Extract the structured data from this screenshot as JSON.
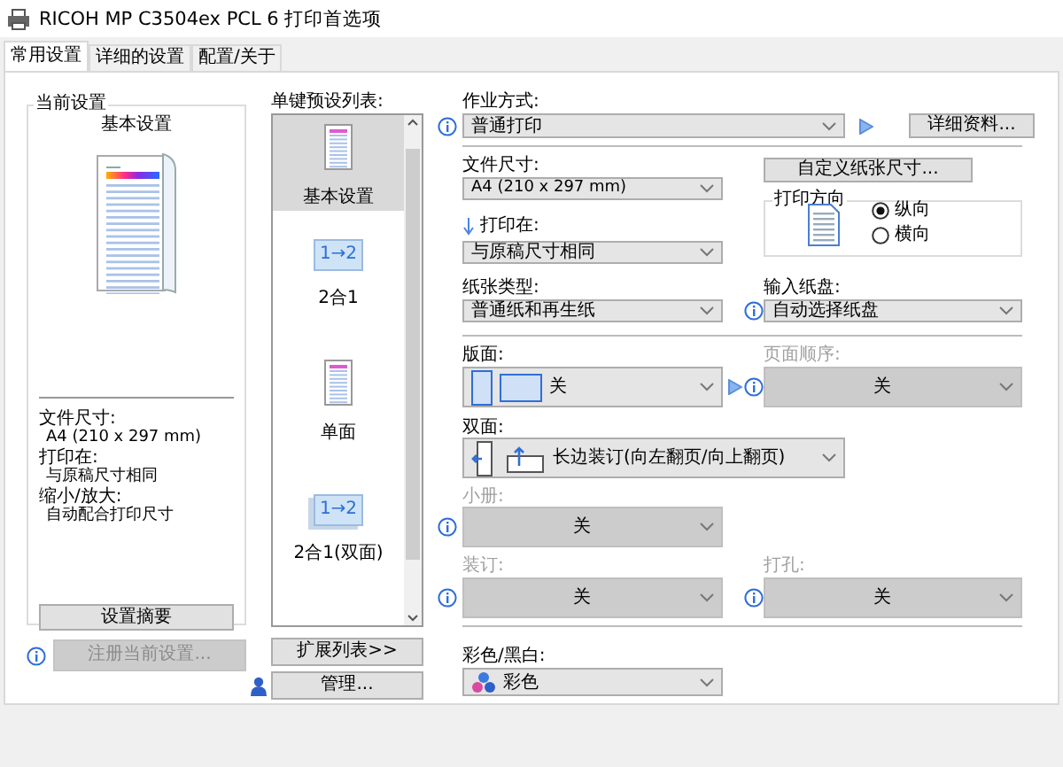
{
  "window": {
    "title": "RICOH MP C3504ex PCL 6 打印首选项"
  },
  "tabs": [
    {
      "label": "常用设置",
      "selected": true
    },
    {
      "label": "详细的设置",
      "selected": false
    },
    {
      "label": "配置/关于",
      "selected": false
    }
  ],
  "current_settings": {
    "title": "当前设置",
    "preset_name": "基本设置",
    "details": [
      {
        "label": "文件尺寸:",
        "value": "A4 (210 x 297 mm)"
      },
      {
        "label": "打印在:",
        "value": "与原稿尺寸相同"
      },
      {
        "label": "缩小/放大:",
        "value": "自动配合打印尺寸"
      }
    ],
    "summary_button": "设置摘要"
  },
  "register_button": {
    "label": "注册当前设置...",
    "disabled": true
  },
  "preset_list": {
    "title": "单键预设列表:",
    "items": [
      {
        "label": "基本设置",
        "kind": "page",
        "selected": true
      },
      {
        "label": "2合1",
        "kind": "combine",
        "icon_text": "1→2",
        "selected": false
      },
      {
        "label": "单面",
        "kind": "page",
        "selected": false
      },
      {
        "label": "2合1(双面)",
        "kind": "combine-duplex",
        "icon_text": "1→2",
        "selected": false
      }
    ],
    "expand_button": "扩展列表>>",
    "manage_button": "管理..."
  },
  "job_type": {
    "label": "作业方式:",
    "value": "普通打印",
    "info": true,
    "disabled": false
  },
  "details_button": "详细资料...",
  "paper_size": {
    "label": "文件尺寸:",
    "value": "A4 (210 x 297 mm)",
    "disabled": false
  },
  "custom_size_button": "自定义纸张尺寸...",
  "print_on": {
    "label": "打印在:",
    "value": "与原稿尺寸相同",
    "disabled": false
  },
  "orientation": {
    "title": "打印方向",
    "options": [
      {
        "label": "纵向",
        "selected": true
      },
      {
        "label": "横向",
        "selected": false
      }
    ]
  },
  "paper_type": {
    "label": "纸张类型:",
    "value": "普通纸和再生纸",
    "disabled": false
  },
  "input_tray": {
    "label": "输入纸盘:",
    "value": "自动选择纸盘",
    "info": true,
    "disabled": false
  },
  "layout": {
    "label": "版面:",
    "value": "关",
    "disabled": false
  },
  "page_order": {
    "label": "页面顺序:",
    "value": "关",
    "info": true,
    "disabled": true
  },
  "duplex": {
    "label": "双面:",
    "value": "长边装订(向左翻页/向上翻页)",
    "disabled": false
  },
  "booklet": {
    "label": "小册:",
    "value": "关",
    "info": true,
    "disabled": true
  },
  "staple": {
    "label": "装订:",
    "value": "关",
    "info": true,
    "disabled": true
  },
  "punch": {
    "label": "打孔:",
    "value": "关",
    "info": true,
    "disabled": true
  },
  "color_mode": {
    "label": "彩色/黑白:",
    "value": "彩色",
    "disabled": false
  }
}
